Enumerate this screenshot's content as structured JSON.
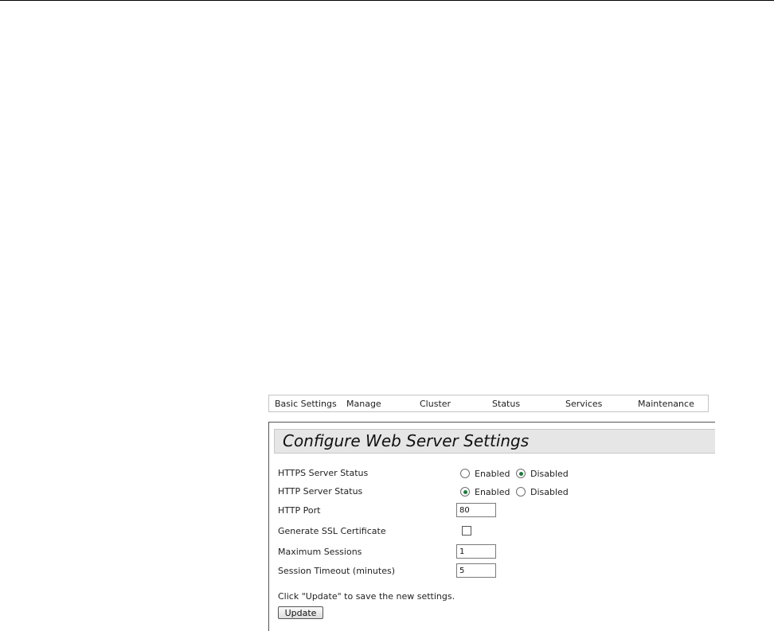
{
  "nav": {
    "items": [
      "Basic Settings",
      "Manage",
      "Cluster",
      "Status",
      "Services",
      "Maintenance"
    ]
  },
  "page": {
    "title": "Configure Web Server Settings"
  },
  "settings": {
    "https_status": {
      "label": "HTTPS Server Status",
      "options": [
        "Enabled",
        "Disabled"
      ],
      "selected": "Disabled"
    },
    "http_status": {
      "label": "HTTP Server Status",
      "options": [
        "Enabled",
        "Disabled"
      ],
      "selected": "Enabled"
    },
    "http_port": {
      "label": "HTTP Port",
      "value": "80"
    },
    "generate_ssl": {
      "label": "Generate SSL Certificate",
      "checked": false
    },
    "max_sessions": {
      "label": "Maximum Sessions",
      "value": "1"
    },
    "session_timeout": {
      "label": "Session Timeout (minutes)",
      "value": "5"
    }
  },
  "footer": {
    "note": "Click \"Update\" to save the new settings.",
    "update_label": "Update"
  },
  "colors": {
    "radio_selected": "#1f7a3d",
    "title_background": "#e6e6e6"
  }
}
